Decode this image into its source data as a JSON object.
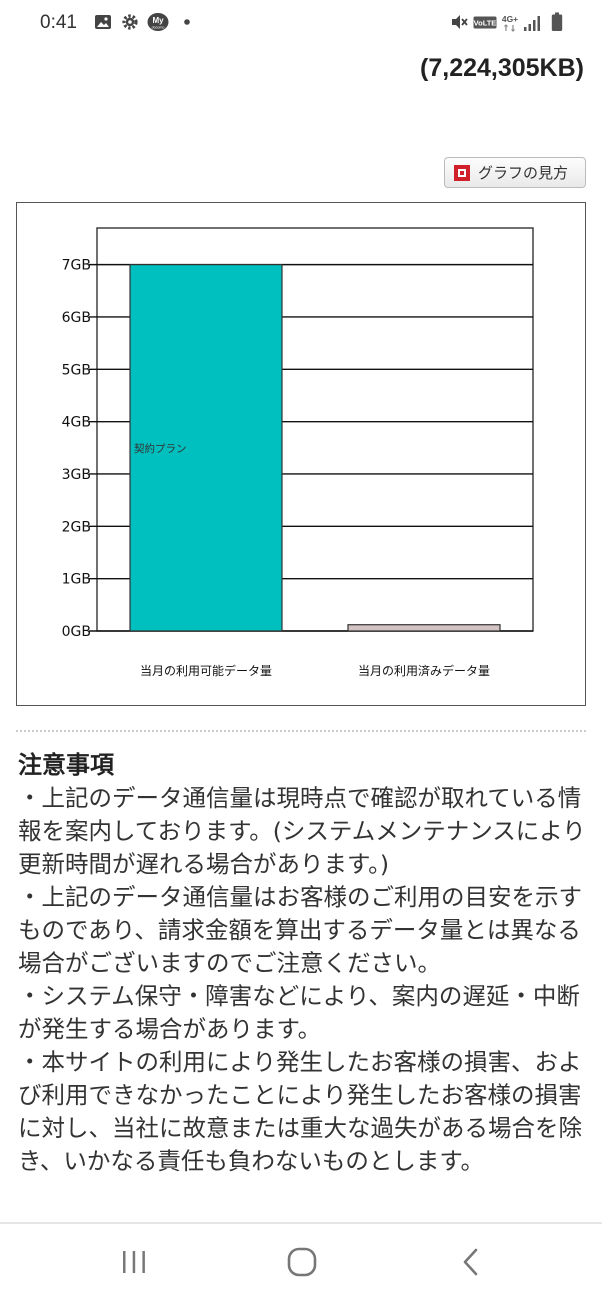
{
  "status_bar": {
    "time": "0:41",
    "left_icons": [
      "image-icon",
      "gear-icon",
      "my-docomo-icon",
      "dot-icon"
    ],
    "right_icons": [
      "mute-icon",
      "volte-icon",
      "network-4g-icon",
      "signal-icon",
      "battery-icon"
    ],
    "volte_text": "VoLTE",
    "network_text": "4G+"
  },
  "total_usage": "(7,224,305KB)",
  "graph_guide_label": "グラフの見方",
  "chart_data": {
    "type": "bar",
    "categories": [
      "当月の利用可能データ量",
      "当月の利用済みデータ量"
    ],
    "values": [
      7,
      0.12
    ],
    "unit": "GB",
    "ylim": [
      0,
      7.7
    ],
    "yticks": [
      "0GB",
      "1GB",
      "2GB",
      "3GB",
      "4GB",
      "5GB",
      "6GB",
      "7GB"
    ],
    "grid": true,
    "bar_colors": [
      "#00bfbf",
      "#d4c3c3"
    ],
    "bar_annotation": "契約プラン"
  },
  "notes": {
    "title": "注意事項",
    "items": [
      "・上記のデータ通信量は現時点で確認が取れている情報を案内しております。(システムメンテナンスにより更新時間が遅れる場合があります。)",
      "・上記のデータ通信量はお客様のご利用の目安を示すものであり、請求金額を算出するデータ量とは異なる場合がございますのでご注意ください。",
      "・システム保守・障害などにより、案内の遅延・中断が発生する場合があります。",
      "・本サイトの利用により発生したお客様の損害、および利用できなかったことにより発生したお客様の損害に対し、当社に故意または重大な過失がある場合を除き、いかなる責任も負わないものとします。"
    ]
  },
  "nav_bar": {
    "buttons": [
      "recent-apps-icon",
      "home-icon",
      "back-icon"
    ]
  }
}
